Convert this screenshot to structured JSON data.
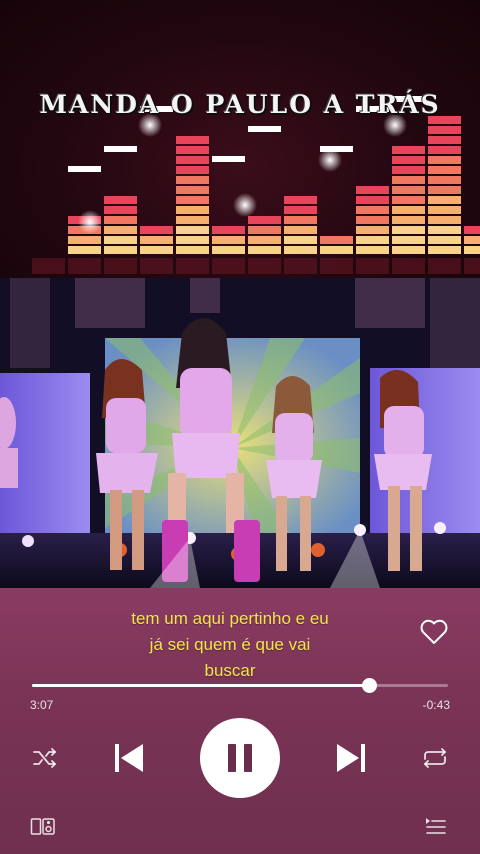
{
  "banner": {
    "title": "MANDA O PAULO A TRÁS"
  },
  "lyrics": {
    "lines": [
      "tem um aqui pertinho e eu",
      "já sei quem é que vai",
      "buscar"
    ],
    "color": "#f3e64a"
  },
  "player": {
    "elapsed": "3:07",
    "remaining": "-0:43",
    "progress": 0.81,
    "liked": false
  },
  "controls": {
    "shuffle_icon": "shuffle-icon",
    "previous_icon": "skip-previous-icon",
    "play_state": "playing",
    "next_icon": "skip-next-icon",
    "repeat_icon": "repeat-icon",
    "devices_icon": "connect-device-icon",
    "queue_icon": "queue-icon"
  },
  "colors": {
    "player_bg": "#7a3456",
    "accent": "#ffffff"
  }
}
